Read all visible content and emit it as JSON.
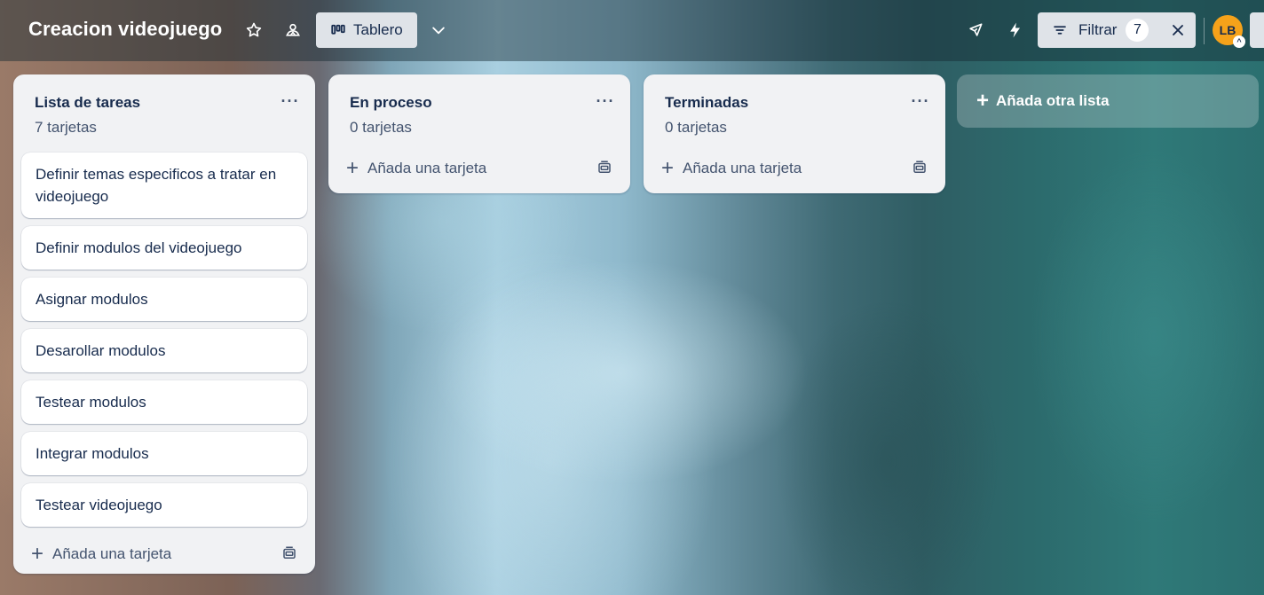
{
  "board": {
    "title": "Creacion videojuego",
    "view_label": "Tablero",
    "filter_label": "Filtrar",
    "filter_count": "7",
    "avatar_initials": "LB",
    "accent_avatar": "#f6a21a"
  },
  "icons": [
    "star-icon",
    "workspace-visibility-icon",
    "board-view-icon",
    "chevron-down-icon",
    "power-ups-rocket-icon",
    "automation-bolt-icon",
    "filter-icon",
    "close-icon",
    "template-icon",
    "plus-icon",
    "more-icon"
  ],
  "lists": [
    {
      "title": "Lista de tareas",
      "count": "7 tarjetas",
      "cards": [
        "Definir temas especificos a tratar en videojuego",
        "Definir modulos del videojuego",
        "Asignar modulos",
        "Desarollar modulos",
        "Testear modulos",
        "Integrar modulos",
        "Testear videojuego"
      ],
      "add_card": "Añada una tarjeta"
    },
    {
      "title": "En proceso",
      "count": "0 tarjetas",
      "cards": [],
      "add_card": "Añada una tarjeta"
    },
    {
      "title": "Terminadas",
      "count": "0 tarjetas",
      "cards": [],
      "add_card": "Añada una tarjeta"
    }
  ],
  "add_list": "Añada otra lista"
}
